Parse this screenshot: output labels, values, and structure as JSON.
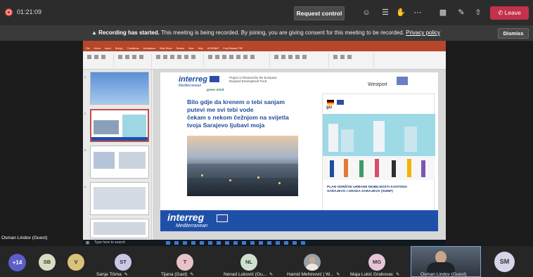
{
  "topbar": {
    "timer": "01:21:09",
    "request_control": "Request control",
    "leave": "Leave",
    "icons": [
      "participants-icon",
      "chat-icon",
      "raise-hand-icon",
      "more-icon",
      "camera-off-icon",
      "mic-off-icon",
      "share-icon"
    ]
  },
  "recording_banner": {
    "title": "Recording has started.",
    "message": "This meeting is being recorded. By joining, you are giving consent for this meeting to be recorded.",
    "link": "Privacy policy",
    "dismiss": "Dismiss"
  },
  "shared_screen": {
    "ppt_tabs": [
      "File",
      "Home",
      "Insert",
      "Design",
      "Transitions",
      "Animations",
      "Slide Show",
      "Review",
      "View",
      "Help",
      "ACROBAT",
      "Foxit Reader PDF"
    ],
    "slide": {
      "brand_top": "interreg",
      "brand_sub": "Mediterranean",
      "green_mind": "green mind",
      "funding": "Project co-financed by the European Regional Development Fund",
      "westport": "Westport",
      "poem_lines": [
        "Bilo gdje da krenem o tebi sanjam",
        "putevi me svi tebi vode",
        "čekam s nekom čežnjom na svijetla",
        "tvoja Sarajevo ljubavi moja"
      ],
      "plan_title_1": "PLAN ODRŽIVE URBANE MOBILNOSTI KANTONA",
      "plan_title_2": "SARAJEVO I GRADA SARAJEVO (SUMP)",
      "published_by": "Published by:",
      "giz": "giz",
      "brand_footer": "interreg",
      "brand_footer_sub": "Mediterranean"
    },
    "taskbar_search": "Type here to search"
  },
  "presenter_label": "Osman Lindov (Guest)",
  "participants": [
    {
      "initials": "+14",
      "name": "",
      "color": "#5b5fc7"
    },
    {
      "initials": "SB",
      "name": "",
      "color": "#d9dcc1"
    },
    {
      "initials": "V",
      "name": "",
      "color": "#d9c27a"
    },
    {
      "initials": "ST",
      "name": "Sanja Tišma",
      "color": "#c9c7e6"
    },
    {
      "initials": "T",
      "name": "Tijana (Gast)",
      "color": "#e7c3c8"
    },
    {
      "initials": "NL",
      "name": "Nenad Luković (Gu...",
      "color": "#cfe0d0"
    },
    {
      "initials": "",
      "name": "Hamid Mehinović | W...",
      "color": "#9aa0a8"
    },
    {
      "initials": "MG",
      "name": "Maja Lukić Grabovac",
      "color": "#e7c3d6"
    },
    {
      "initials": "",
      "name": "Osman Lindov (Guest)",
      "color": "#3a4452"
    },
    {
      "initials": "SM",
      "name": "",
      "color": "#d6d4e8"
    }
  ]
}
